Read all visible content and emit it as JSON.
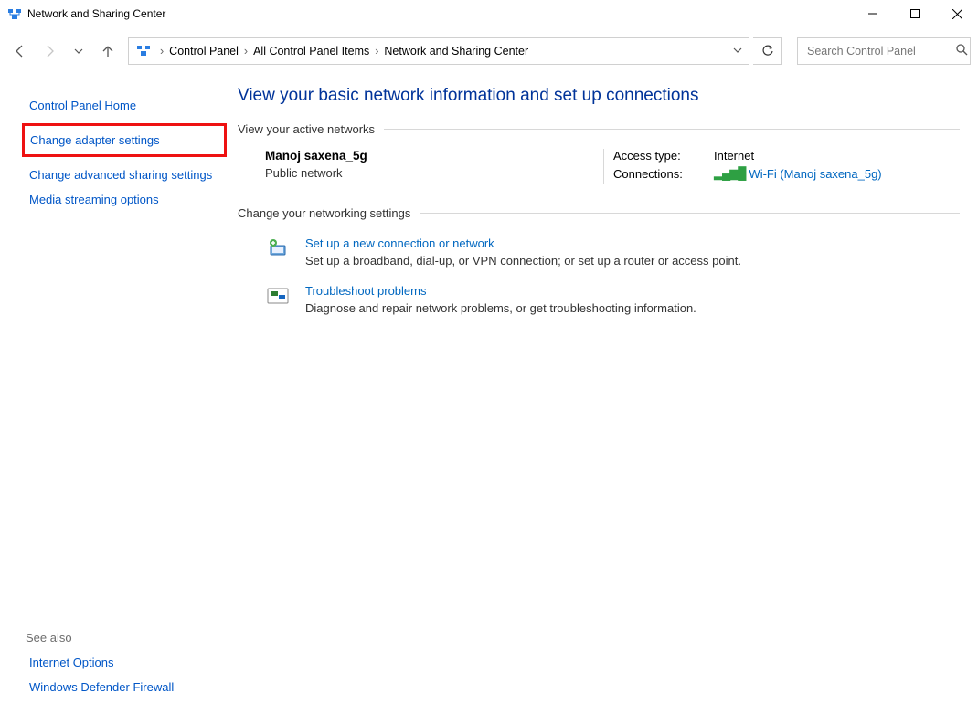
{
  "window": {
    "title": "Network and Sharing Center"
  },
  "breadcrumb": {
    "items": [
      "Control Panel",
      "All Control Panel Items",
      "Network and Sharing Center"
    ]
  },
  "search": {
    "placeholder": "Search Control Panel"
  },
  "sidebar": {
    "home": "Control Panel Home",
    "adapter": "Change adapter settings",
    "advanced": "Change advanced sharing settings",
    "media": "Media streaming options"
  },
  "see_also": {
    "heading": "See also",
    "internet_options": "Internet Options",
    "firewall": "Windows Defender Firewall"
  },
  "main": {
    "title": "View your basic network information and set up connections",
    "active_heading": "View your active networks",
    "network": {
      "name": "Manoj saxena_5g",
      "type": "Public network",
      "access_label": "Access type:",
      "access_value": "Internet",
      "conn_label": "Connections:",
      "conn_value": "Wi-Fi (Manoj saxena_5g)"
    },
    "change_heading": "Change your networking settings",
    "task1": {
      "title": "Set up a new connection or network",
      "desc": "Set up a broadband, dial-up, or VPN connection; or set up a router or access point."
    },
    "task2": {
      "title": "Troubleshoot problems",
      "desc": "Diagnose and repair network problems, or get troubleshooting information."
    }
  }
}
